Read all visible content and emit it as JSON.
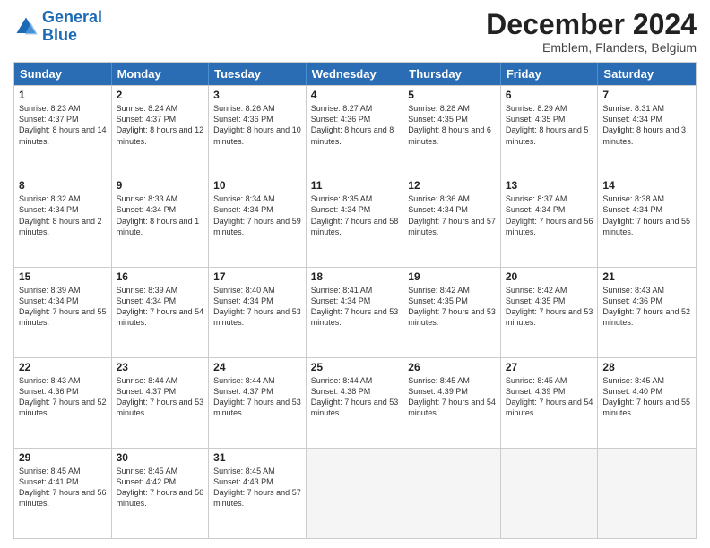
{
  "logo": {
    "line1": "General",
    "line2": "Blue"
  },
  "title": "December 2024",
  "subtitle": "Emblem, Flanders, Belgium",
  "header": {
    "days": [
      "Sunday",
      "Monday",
      "Tuesday",
      "Wednesday",
      "Thursday",
      "Friday",
      "Saturday"
    ]
  },
  "weeks": [
    [
      {
        "day": "1",
        "sunrise": "8:23 AM",
        "sunset": "4:37 PM",
        "daylight": "8 hours and 14 minutes."
      },
      {
        "day": "2",
        "sunrise": "8:24 AM",
        "sunset": "4:37 PM",
        "daylight": "8 hours and 12 minutes."
      },
      {
        "day": "3",
        "sunrise": "8:26 AM",
        "sunset": "4:36 PM",
        "daylight": "8 hours and 10 minutes."
      },
      {
        "day": "4",
        "sunrise": "8:27 AM",
        "sunset": "4:36 PM",
        "daylight": "8 hours and 8 minutes."
      },
      {
        "day": "5",
        "sunrise": "8:28 AM",
        "sunset": "4:35 PM",
        "daylight": "8 hours and 6 minutes."
      },
      {
        "day": "6",
        "sunrise": "8:29 AM",
        "sunset": "4:35 PM",
        "daylight": "8 hours and 5 minutes."
      },
      {
        "day": "7",
        "sunrise": "8:31 AM",
        "sunset": "4:34 PM",
        "daylight": "8 hours and 3 minutes."
      }
    ],
    [
      {
        "day": "8",
        "sunrise": "8:32 AM",
        "sunset": "4:34 PM",
        "daylight": "8 hours and 2 minutes."
      },
      {
        "day": "9",
        "sunrise": "8:33 AM",
        "sunset": "4:34 PM",
        "daylight": "8 hours and 1 minute."
      },
      {
        "day": "10",
        "sunrise": "8:34 AM",
        "sunset": "4:34 PM",
        "daylight": "7 hours and 59 minutes."
      },
      {
        "day": "11",
        "sunrise": "8:35 AM",
        "sunset": "4:34 PM",
        "daylight": "7 hours and 58 minutes."
      },
      {
        "day": "12",
        "sunrise": "8:36 AM",
        "sunset": "4:34 PM",
        "daylight": "7 hours and 57 minutes."
      },
      {
        "day": "13",
        "sunrise": "8:37 AM",
        "sunset": "4:34 PM",
        "daylight": "7 hours and 56 minutes."
      },
      {
        "day": "14",
        "sunrise": "8:38 AM",
        "sunset": "4:34 PM",
        "daylight": "7 hours and 55 minutes."
      }
    ],
    [
      {
        "day": "15",
        "sunrise": "8:39 AM",
        "sunset": "4:34 PM",
        "daylight": "7 hours and 55 minutes."
      },
      {
        "day": "16",
        "sunrise": "8:39 AM",
        "sunset": "4:34 PM",
        "daylight": "7 hours and 54 minutes."
      },
      {
        "day": "17",
        "sunrise": "8:40 AM",
        "sunset": "4:34 PM",
        "daylight": "7 hours and 53 minutes."
      },
      {
        "day": "18",
        "sunrise": "8:41 AM",
        "sunset": "4:34 PM",
        "daylight": "7 hours and 53 minutes."
      },
      {
        "day": "19",
        "sunrise": "8:42 AM",
        "sunset": "4:35 PM",
        "daylight": "7 hours and 53 minutes."
      },
      {
        "day": "20",
        "sunrise": "8:42 AM",
        "sunset": "4:35 PM",
        "daylight": "7 hours and 53 minutes."
      },
      {
        "day": "21",
        "sunrise": "8:43 AM",
        "sunset": "4:36 PM",
        "daylight": "7 hours and 52 minutes."
      }
    ],
    [
      {
        "day": "22",
        "sunrise": "8:43 AM",
        "sunset": "4:36 PM",
        "daylight": "7 hours and 52 minutes."
      },
      {
        "day": "23",
        "sunrise": "8:44 AM",
        "sunset": "4:37 PM",
        "daylight": "7 hours and 53 minutes."
      },
      {
        "day": "24",
        "sunrise": "8:44 AM",
        "sunset": "4:37 PM",
        "daylight": "7 hours and 53 minutes."
      },
      {
        "day": "25",
        "sunrise": "8:44 AM",
        "sunset": "4:38 PM",
        "daylight": "7 hours and 53 minutes."
      },
      {
        "day": "26",
        "sunrise": "8:45 AM",
        "sunset": "4:39 PM",
        "daylight": "7 hours and 54 minutes."
      },
      {
        "day": "27",
        "sunrise": "8:45 AM",
        "sunset": "4:39 PM",
        "daylight": "7 hours and 54 minutes."
      },
      {
        "day": "28",
        "sunrise": "8:45 AM",
        "sunset": "4:40 PM",
        "daylight": "7 hours and 55 minutes."
      }
    ],
    [
      {
        "day": "29",
        "sunrise": "8:45 AM",
        "sunset": "4:41 PM",
        "daylight": "7 hours and 56 minutes."
      },
      {
        "day": "30",
        "sunrise": "8:45 AM",
        "sunset": "4:42 PM",
        "daylight": "7 hours and 56 minutes."
      },
      {
        "day": "31",
        "sunrise": "8:45 AM",
        "sunset": "4:43 PM",
        "daylight": "7 hours and 57 minutes."
      },
      null,
      null,
      null,
      null
    ]
  ]
}
